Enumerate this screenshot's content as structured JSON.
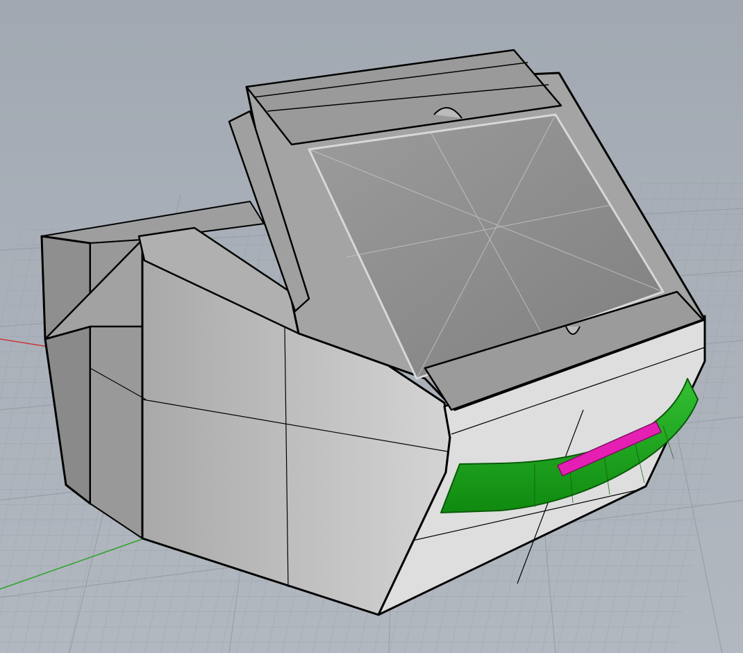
{
  "app": {
    "name": "",
    "viewport_label": ""
  },
  "viewport": {
    "projection": "perspective",
    "display_mode": "ghosted",
    "grid": true,
    "axes": [
      "x-axis-red",
      "y-axis-green"
    ]
  },
  "model": {
    "body_color": "#c9c9c9",
    "edge_color": "#000000",
    "glass_color": "#8e8e8e",
    "handle_color": "#17a417",
    "selected_color": "#e51fb4"
  }
}
